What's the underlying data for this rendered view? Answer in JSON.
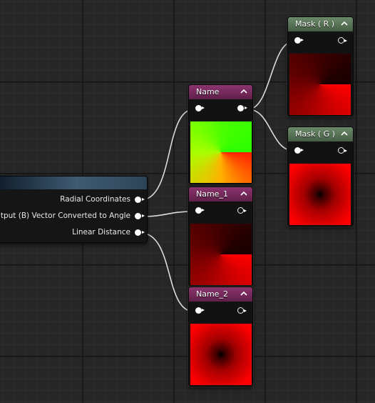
{
  "header_colors": {
    "name_nodes": "#7a2a5e",
    "mask_nodes": "#5c7a5a"
  },
  "source_node": {
    "outputs": [
      {
        "label": "Radial Coordinates"
      },
      {
        "label": "Output (B) Vector Converted to Angle"
      },
      {
        "label": "Linear Distance"
      }
    ]
  },
  "nodes": {
    "name": {
      "title": "Name"
    },
    "name_1": {
      "title": "Name_1"
    },
    "name_2": {
      "title": "Name_2"
    },
    "mask_r": {
      "title": "Mask ( R )"
    },
    "mask_g": {
      "title": "Mask ( G )"
    }
  },
  "icons": {
    "collapse": "chevron-up-icon",
    "pin": "exec-pin-icon"
  }
}
